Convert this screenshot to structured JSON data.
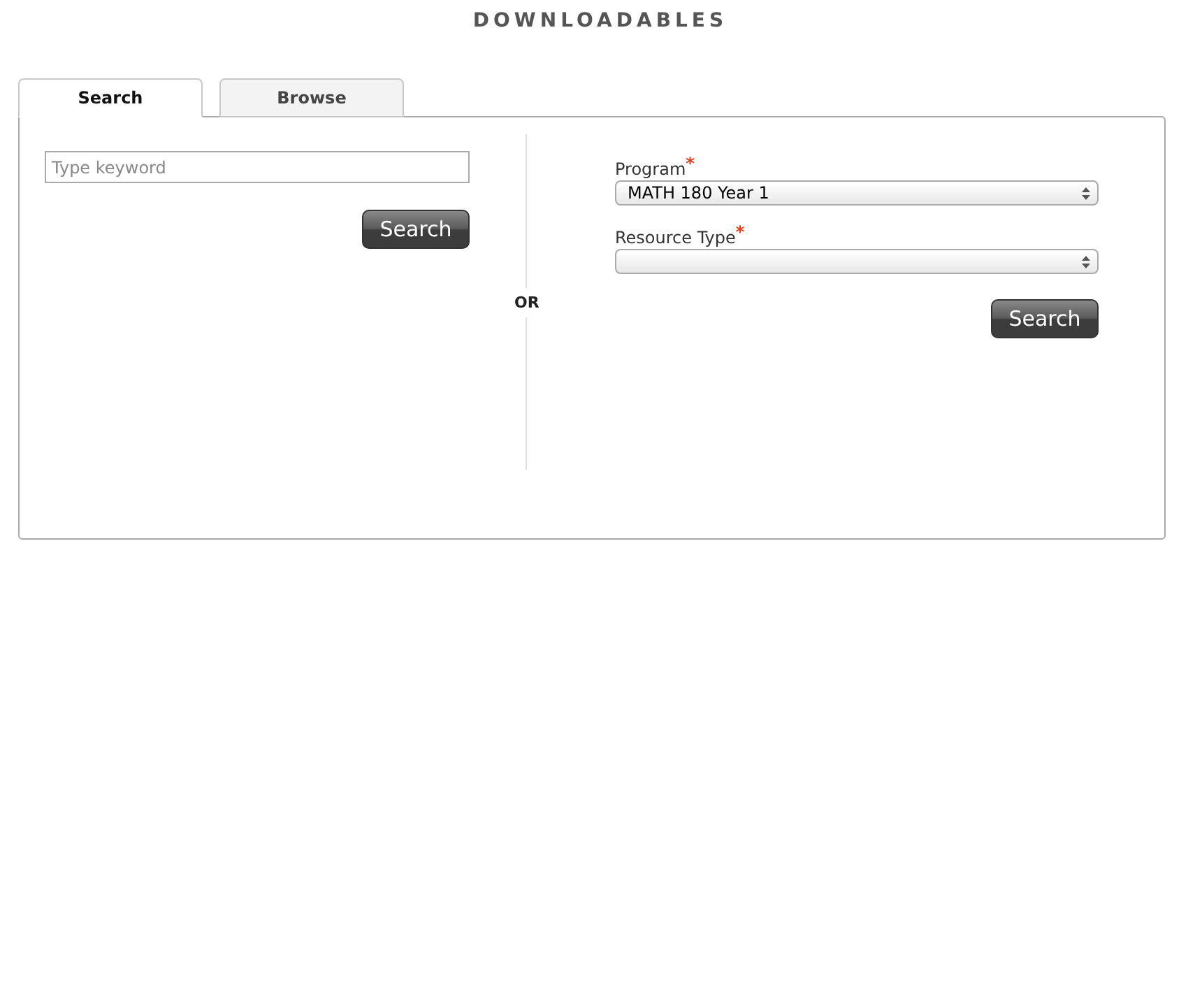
{
  "title": "DOWNLOADABLES",
  "tabs": [
    {
      "label": "Search",
      "selected": true
    },
    {
      "label": "Browse",
      "selected": false
    }
  ],
  "keyword_search": {
    "placeholder": "Type keyword",
    "button": "Search"
  },
  "separator": "OR",
  "filters": [
    {
      "label": "Program",
      "required_mark": "*",
      "value": "MATH 180 Year 1"
    },
    {
      "label": "Resource Type",
      "required_mark": "*"
    }
  ],
  "filter_button": "Search"
}
